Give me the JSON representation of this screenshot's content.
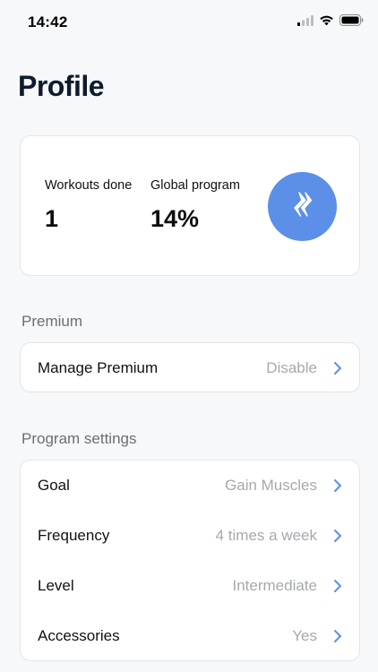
{
  "status_bar": {
    "time": "14:42",
    "icons": [
      "signal-icon",
      "wifi-icon",
      "battery-icon"
    ]
  },
  "title": "Profile",
  "stats": {
    "workouts_label": "Workouts done",
    "workouts_value": "1",
    "global_label": "Global program",
    "global_value": "14%",
    "badge_icon": "lightning-bolt-icon",
    "badge_color": "#5b8fe8"
  },
  "premium": {
    "section_label": "Premium",
    "rows": [
      {
        "label": "Manage Premium",
        "value": "Disable"
      }
    ]
  },
  "program_settings": {
    "section_label": "Program settings",
    "rows": [
      {
        "label": "Goal",
        "value": "Gain Muscles"
      },
      {
        "label": "Frequency",
        "value": "4 times a week"
      },
      {
        "label": "Level",
        "value": "Intermediate"
      },
      {
        "label": "Accessories",
        "value": "Yes"
      }
    ]
  },
  "colors": {
    "accent": "#5b8fe8",
    "chevron": "#5b8fe8",
    "muted_text": "#a5a9ae",
    "background": "#f7f8fa"
  }
}
